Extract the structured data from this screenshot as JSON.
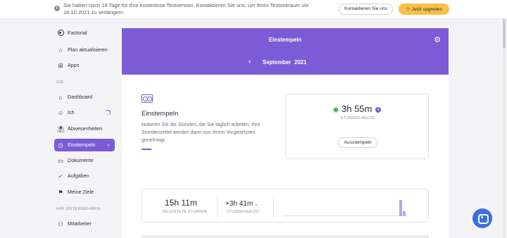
{
  "banner": {
    "message": "Sie haben noch 19 Tage für Ihre kostenlose Testversion. Kontaktieren Sie uns, um Ihren Testzeitraum vor 18.10.2021 zu verlängern",
    "contact_label": "Kontaktieren Sie uns",
    "upgrade_label": "Jetzt upgreden"
  },
  "sidebar": {
    "brand": "Factorial",
    "top_items": [
      {
        "label": "Plan aktualisieren",
        "icon": "star-icon"
      },
      {
        "label": "Apps",
        "icon": "apps-icon"
      }
    ],
    "section_you": "SIE",
    "items": [
      {
        "label": "Dashboard",
        "icon": "home-icon"
      },
      {
        "label": "Ich",
        "icon": "person-icon"
      },
      {
        "label": "Abwesenheiten",
        "icon": "beach-icon"
      },
      {
        "label": "Einstempeln",
        "icon": "clock-icon",
        "active": true
      },
      {
        "label": "Dokumente",
        "icon": "folder-icon"
      },
      {
        "label": "Aufgaben",
        "icon": "check-icon"
      },
      {
        "label": "Meine Ziele",
        "icon": "flag-icon"
      }
    ],
    "section_company": "IHR UNTERNEHMEN",
    "company_items": [
      {
        "label": "Mitarbeiter",
        "icon": "people-icon"
      }
    ]
  },
  "header": {
    "title": "Einstempeln",
    "month": "September",
    "year": "2021"
  },
  "clock_in": {
    "title": "Einstempeln",
    "description": "Notieren Sie die Stunden, die Sie täglich arbeiten. Ihre Stundenzettel werden dann von Ihrem Vorgesetzten genehmigt.",
    "hours_today": "3h 55m",
    "hours_today_label": "STUNDEN HEUTE",
    "clock_out_label": "Ausstempeln"
  },
  "stats": {
    "worked_hours": "15h 11m",
    "worked_hours_label": "GELEISTETE STUNDEN",
    "balance": "+3h 41m",
    "balance_label": "STUNDENSALDO"
  },
  "colors": {
    "accent": "#7c5cd6",
    "warning": "#f9c146",
    "success": "#3fb950",
    "help": "#3d6fe0"
  }
}
